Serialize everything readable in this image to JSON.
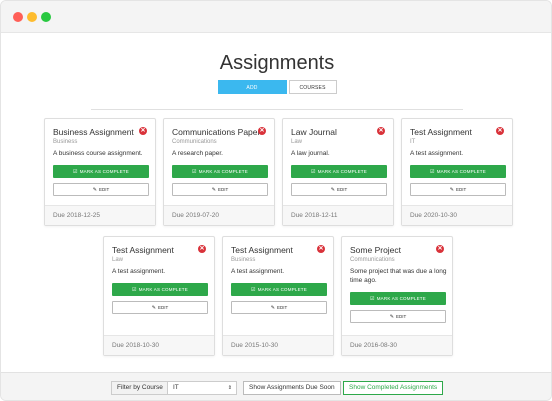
{
  "page": {
    "title": "Assignments"
  },
  "tabs": {
    "add": "ADD ASSIGNMENT",
    "courses": "COURSES"
  },
  "buttons": {
    "mark_complete": "MARK AS COMPLETE",
    "edit": "EDIT"
  },
  "cards": [
    {
      "title": "Business Assignment",
      "course": "Business",
      "description": "A business course assignment.",
      "due": "Due 2018-12-25"
    },
    {
      "title": "Communications Paper",
      "course": "Communications",
      "description": "A research paper.",
      "due": "Due 2019-07-20"
    },
    {
      "title": "Law Journal",
      "course": "Law",
      "description": "A law journal.",
      "due": "Due 2018-12-11"
    },
    {
      "title": "Test Assignment",
      "course": "IT",
      "description": "A test assignment.",
      "due": "Due 2020-10-30"
    },
    {
      "title": "Test Assignment",
      "course": "Law",
      "description": "A test assignment.",
      "due": "Due 2018-10-30"
    },
    {
      "title": "Test Assignment",
      "course": "Business",
      "description": "A test assignment.",
      "due": "Due 2015-10-30"
    },
    {
      "title": "Some Project",
      "course": "Communications",
      "description": "Some project that was due a long time ago.",
      "due": "Due 2016-08-30"
    }
  ],
  "filter": {
    "label": "Filter by Course",
    "selected": "IT",
    "due_soon": "Show Assignments Due Soon",
    "completed": "Show Completed Assignments"
  },
  "colors": {
    "accent": "#3bb8ef",
    "complete": "#2ea84a",
    "delete": "#d9323a"
  }
}
